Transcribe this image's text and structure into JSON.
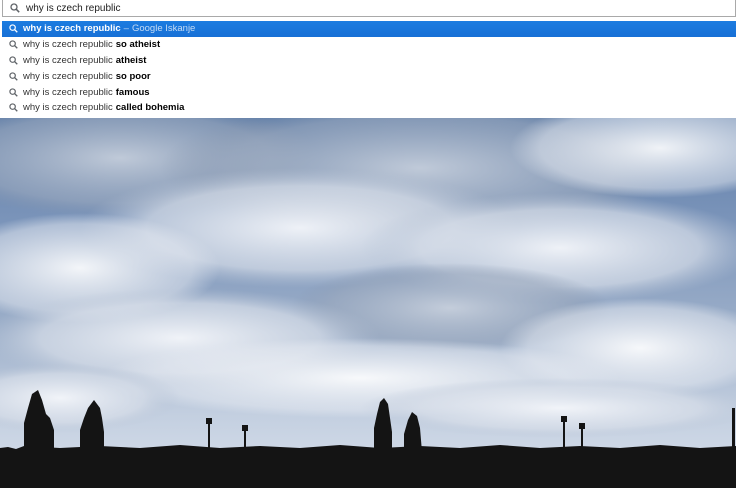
{
  "omnibox": {
    "value": "why is czech republic",
    "icon": "search-icon"
  },
  "suggestions": [
    {
      "base": "why is czech republic",
      "bold": "",
      "separator": "–",
      "source": "Google Iskanje",
      "selected": true
    },
    {
      "base": "why is czech republic",
      "bold": "so atheist",
      "selected": false
    },
    {
      "base": "why is czech republic",
      "bold": "atheist",
      "selected": false
    },
    {
      "base": "why is czech republic",
      "bold": "so poor",
      "selected": false
    },
    {
      "base": "why is czech republic",
      "bold": "famous",
      "selected": false
    },
    {
      "base": "why is czech republic",
      "bold": "called bohemia",
      "selected": false
    }
  ],
  "background_photo": {
    "subject": "charles-bridge-silhouette-under-cloudy-sky"
  },
  "colors": {
    "selected_row": "#1770d6",
    "sky": "#7d96bb",
    "silhouette": "#141414"
  }
}
